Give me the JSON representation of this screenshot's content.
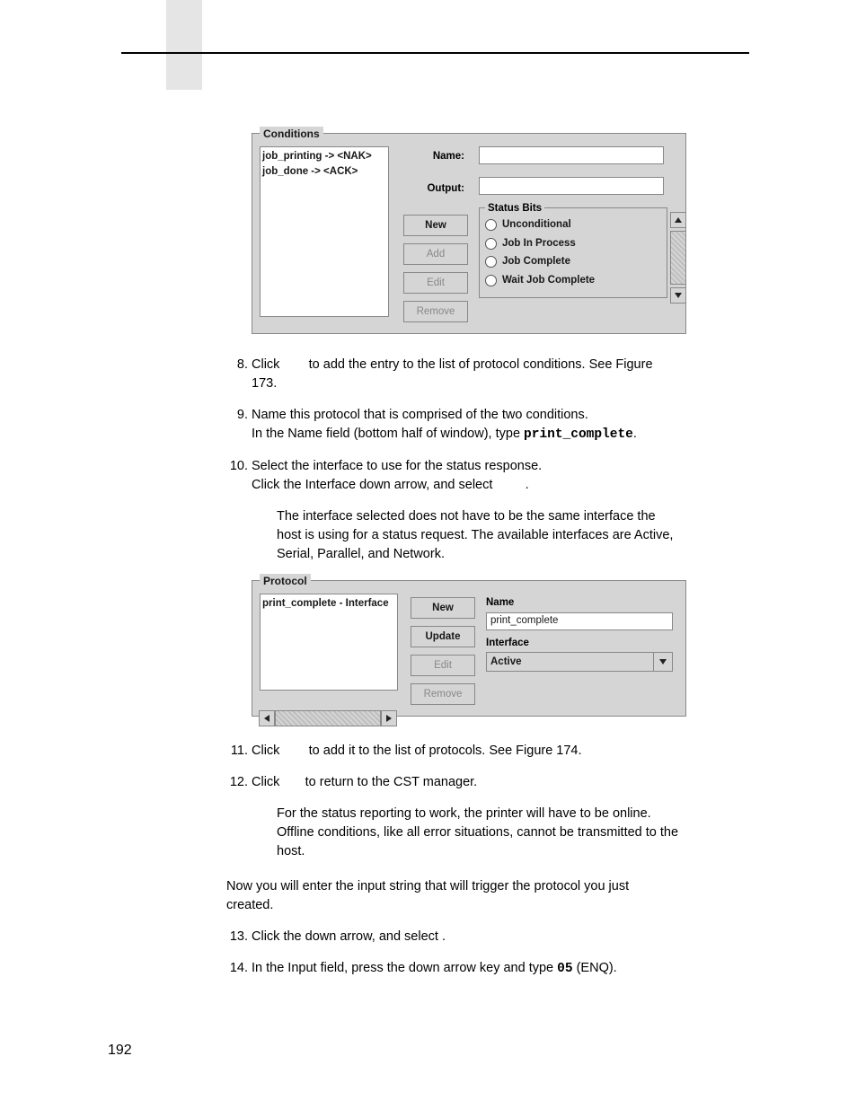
{
  "conditions_panel": {
    "legend": "Conditions",
    "list_items": [
      "job_printing -> <NAK>",
      "job_done -> <ACK>"
    ],
    "labels": {
      "name": "Name:",
      "output": "Output:"
    },
    "buttons": {
      "new": "New",
      "add": "Add",
      "edit": "Edit",
      "remove": "Remove"
    },
    "status_bits": {
      "legend": "Status Bits",
      "options": [
        "Unconditional",
        "Job In Process",
        "Job Complete",
        "Wait Job Complete"
      ]
    }
  },
  "step8_a": "Click ",
  "step8_b": " to add the entry to the list of protocol conditions. See Figure 173.",
  "step9_a": "Name this protocol that is comprised of the two conditions.",
  "step9_b_pre": "In the Name field (bottom half of window), type ",
  "step9_b_code": "print_complete",
  "step9_b_post": ".",
  "step10_a": "Select the interface to use for the status response.",
  "step10_b": "Click the Interface down arrow, and select ",
  "step10_b_post": ".",
  "note1": "The interface selected does not have to be the same interface the host is using for a status request. The available interfaces are Active, Serial, Parallel, and Network.",
  "protocol_panel": {
    "legend": "Protocol",
    "list_items": [
      "print_complete - Interface"
    ],
    "buttons": {
      "new": "New",
      "update": "Update",
      "edit": "Edit",
      "remove": "Remove"
    },
    "labels": {
      "name": "Name",
      "interface": "Interface"
    },
    "name_value": "print_complete",
    "interface_value": "Active"
  },
  "step11_a": "Click ",
  "step11_b": " to add it to the list of protocols. See Figure 174.",
  "step12_a": "Click ",
  "step12_b": " to return to the CST manager.",
  "note2": "For the status reporting to work, the printer will have to be online. Offline conditions, like all error situations, cannot be transmitted to the host.",
  "para_after": "Now you will enter the input string that will trigger the protocol you just created.",
  "step13": "Click the          down arrow, and select                  .",
  "step14_a": "In the Input field, press the down arrow key and type ",
  "step14_code": "05",
  "step14_b": " (ENQ).",
  "page_number": "192"
}
